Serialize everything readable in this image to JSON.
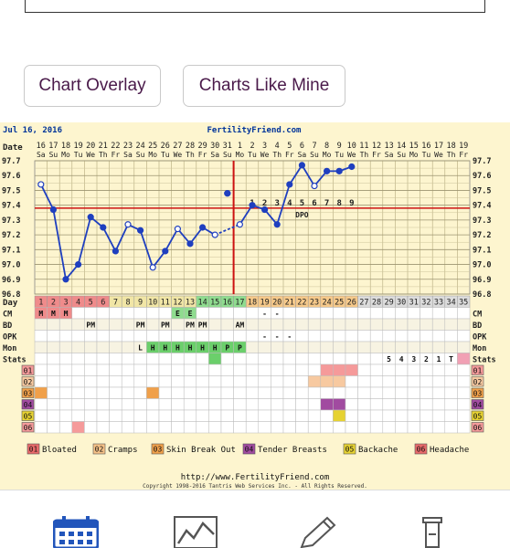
{
  "top_box": {
    "text": ""
  },
  "buttons": {
    "overlay": "Chart Overlay",
    "like": "Charts Like Mine"
  },
  "chart_data": {
    "type": "line",
    "date_label": "Jul 16, 2016",
    "site": "FertilityFriend.com",
    "footer_url": "http://www.FertilityFriend.com",
    "copyright": "Copyright 1998-2016 Tantris Web Services Inc. - All Rights Reserved.",
    "row_label_date": "Date",
    "row_label_day": "Day",
    "dates": [
      "16",
      "17",
      "18",
      "19",
      "20",
      "21",
      "22",
      "23",
      "24",
      "25",
      "26",
      "27",
      "28",
      "29",
      "30",
      "31",
      "1",
      "2",
      "3",
      "4",
      "5",
      "6",
      "7",
      "8",
      "9",
      "10",
      "11",
      "12",
      "13",
      "14",
      "15",
      "16",
      "17",
      "18",
      "19"
    ],
    "weekdays": [
      "Sa",
      "Su",
      "Mo",
      "Tu",
      "We",
      "Th",
      "Fr",
      "Sa",
      "Su",
      "Mo",
      "Tu",
      "We",
      "Th",
      "Fr",
      "Sa",
      "Su",
      "Mo",
      "Tu",
      "We",
      "Th",
      "Fr",
      "Sa",
      "Su",
      "Mo",
      "Tu",
      "We",
      "Th",
      "Fr",
      "Sa",
      "Su",
      "Mo",
      "Tu",
      "We",
      "Th",
      "Fr"
    ],
    "days": [
      "1",
      "2",
      "3",
      "4",
      "5",
      "6",
      "7",
      "8",
      "9",
      "10",
      "11",
      "12",
      "13",
      "14",
      "15",
      "16",
      "17",
      "18",
      "19",
      "20",
      "21",
      "22",
      "23",
      "24",
      "25",
      "26",
      "27",
      "28",
      "29",
      "30",
      "31",
      "32",
      "33",
      "34",
      "35"
    ],
    "y_ticks": [
      "97.7",
      "97.6",
      "97.5",
      "97.4",
      "97.3",
      "97.2",
      "97.1",
      "97.0",
      "96.9",
      "96.8"
    ],
    "ylim": [
      96.8,
      97.7
    ],
    "temps": [
      {
        "day": 1,
        "value": 97.54,
        "open": true
      },
      {
        "day": 2,
        "value": 97.37
      },
      {
        "day": 3,
        "value": 96.9
      },
      {
        "day": 4,
        "value": 97.0
      },
      {
        "day": 5,
        "value": 97.32
      },
      {
        "day": 6,
        "value": 97.25
      },
      {
        "day": 7,
        "value": 97.09
      },
      {
        "day": 8,
        "value": 97.27,
        "open": true
      },
      {
        "day": 9,
        "value": 97.23
      },
      {
        "day": 10,
        "value": 96.98,
        "open": true
      },
      {
        "day": 11,
        "value": 97.09
      },
      {
        "day": 12,
        "value": 97.24,
        "open": true
      },
      {
        "day": 13,
        "value": 97.14
      },
      {
        "day": 14,
        "value": 97.25
      },
      {
        "day": 15,
        "value": 97.2,
        "open": true
      },
      {
        "day": 17,
        "value": 97.27,
        "open": true,
        "dashed_from_prev": true
      },
      {
        "day": 18,
        "value": 97.4
      },
      {
        "day": 19,
        "value": 97.37
      },
      {
        "day": 20,
        "value": 97.27
      },
      {
        "day": 21,
        "value": 97.54
      },
      {
        "day": 22,
        "value": 97.67
      },
      {
        "day": 23,
        "value": 97.53,
        "open": true
      },
      {
        "day": 24,
        "value": 97.63
      },
      {
        "day": 25,
        "value": 97.63
      },
      {
        "day": 26,
        "value": 97.66
      }
    ],
    "outlier": {
      "day": 16,
      "value": 97.48
    },
    "coverline": 97.38,
    "ovulation_day": 17,
    "dpo_numbers": [
      "1",
      "2",
      "3",
      "4",
      "5",
      "6",
      "7",
      "8",
      "9"
    ],
    "dpo_label": "DPO",
    "rows": {
      "CM": {
        "label": "CM",
        "cells": {
          "1": "M",
          "2": "M",
          "3": "M",
          "19": "-",
          "20": "-"
        }
      },
      "BD": {
        "label": "BD",
        "cells": {
          "5": "PM",
          "9": "PM",
          "11": "PM",
          "13": "PM",
          "14": "PM",
          "17": "AM"
        }
      },
      "OPK": {
        "label": "OPK",
        "cells": {
          "19": "-",
          "20": "-",
          "21": "-"
        }
      },
      "Mon": {
        "label": "Mon",
        "cells": {
          "9": "L",
          "10": "H",
          "11": "H",
          "12": "H",
          "13": "H",
          "14": "H",
          "15": "H",
          "16": "P",
          "17": "P"
        }
      },
      "Stats": {
        "label": "Stats",
        "cells": {
          "29": "5",
          "30": "4",
          "31": "3",
          "32": "2",
          "33": "1",
          "34": "T"
        }
      }
    },
    "extra_row_texts": {
      "12": "E",
      "13": "E"
    },
    "symptom_rows": [
      "01",
      "02",
      "03",
      "04",
      "05",
      "06"
    ],
    "legend": [
      {
        "code": "01",
        "label": "Bloated",
        "color": "#e96a6a"
      },
      {
        "code": "02",
        "label": "Cramps",
        "color": "#f5c187"
      },
      {
        "code": "03",
        "label": "Skin Break Out",
        "color": "#f0a04a"
      },
      {
        "code": "04",
        "label": "Tender Breasts",
        "color": "#a14ba0"
      },
      {
        "code": "05",
        "label": "Backache",
        "color": "#e6d232"
      },
      {
        "code": "06",
        "label": "Headache",
        "color": "#e96a6a"
      }
    ]
  },
  "nav": [
    {
      "name": "calendar-icon",
      "color": "#2255bb"
    },
    {
      "name": "chart-icon",
      "color": "#666666"
    },
    {
      "name": "pencil-icon",
      "color": "#666666"
    },
    {
      "name": "test-tube-icon",
      "color": "#666666"
    }
  ]
}
